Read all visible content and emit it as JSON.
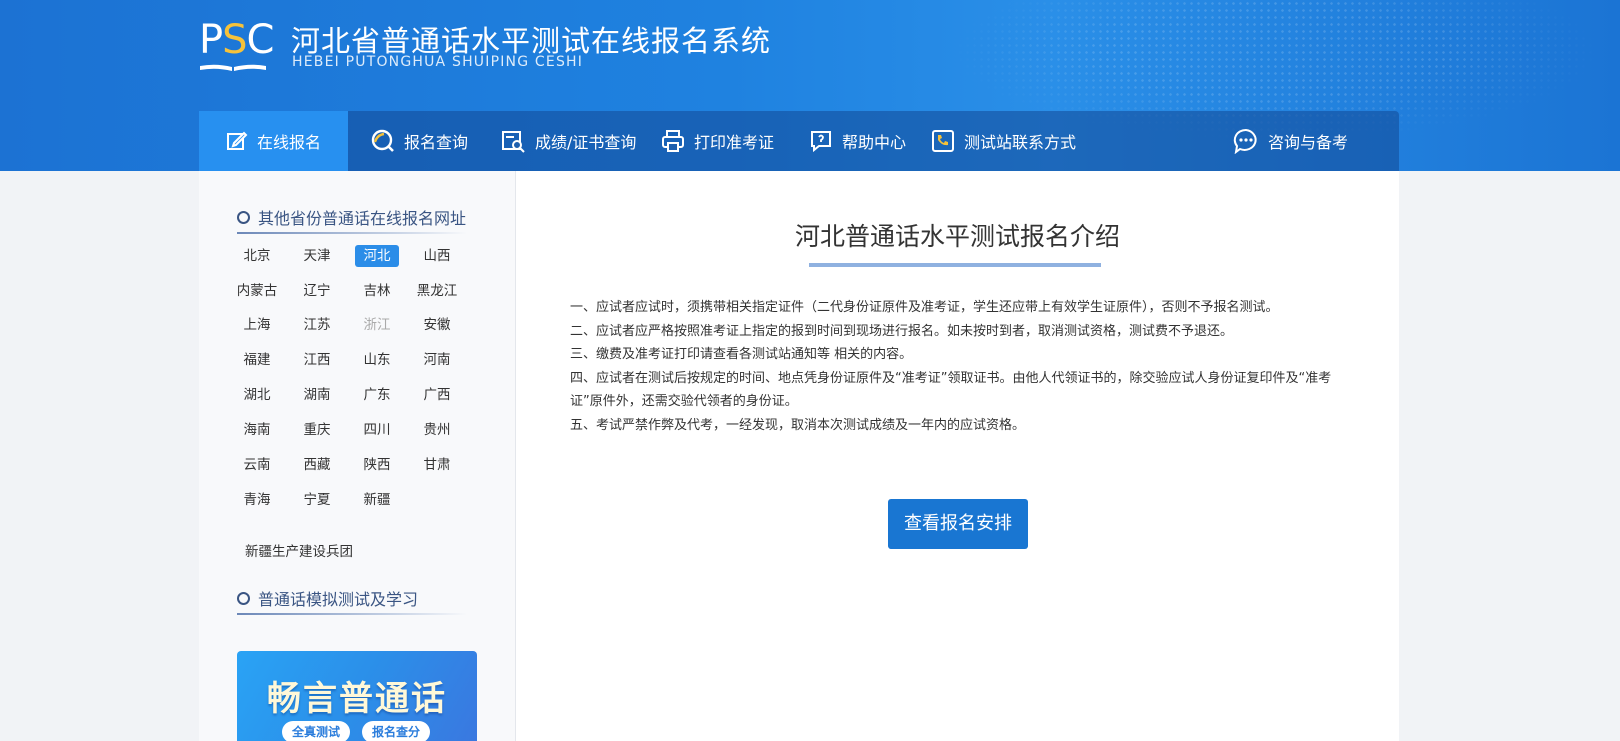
{
  "header": {
    "logo_text_p": "P",
    "logo_text_s": "S",
    "logo_text_c": "C",
    "title": "河北省普通话水平测试在线报名系统",
    "subtitle": "HEBEI PUTONGHUA SHUIPING CESHI"
  },
  "nav": {
    "items": [
      {
        "label": "在线报名",
        "icon": "edit-icon",
        "active": true
      },
      {
        "label": "报名查询",
        "icon": "search-ring-icon"
      },
      {
        "label": "成绩/证书查询",
        "icon": "certificate-search-icon"
      },
      {
        "label": "打印准考证",
        "icon": "printer-icon"
      },
      {
        "label": "帮助中心",
        "icon": "help-icon"
      },
      {
        "label": "测试站联系方式",
        "icon": "phone-icon"
      },
      {
        "label": "咨询与备考",
        "icon": "chat-icon"
      }
    ]
  },
  "sidebar": {
    "provinces_heading": "其他省份普通话在线报名网址",
    "provinces": [
      "北京",
      "天津",
      "河北",
      "山西",
      "内蒙古",
      "辽宁",
      "吉林",
      "黑龙江",
      "上海",
      "江苏",
      "浙江",
      "安徽",
      "福建",
      "江西",
      "山东",
      "河南",
      "湖北",
      "湖南",
      "广东",
      "广西",
      "海南",
      "重庆",
      "四川",
      "贵州",
      "云南",
      "西藏",
      "陕西",
      "甘肃",
      "青海",
      "宁夏",
      "新疆"
    ],
    "active_province": "河北",
    "muted_province": "浙江",
    "extra_link": "新疆生产建设兵团",
    "study_heading": "普通话模拟测试及学习",
    "banner": {
      "title": "畅言普通话",
      "pill_left": "全真测试",
      "pill_right": "报名查分"
    }
  },
  "content": {
    "title": "河北普通话水平测试报名介绍",
    "notes": [
      "一、应试者应试时，须携带相关指定证件（二代身份证原件及准考证，学生还应带上有效学生证原件），否则不予报名测试。",
      "二、应试者应严格按照准考证上指定的报到时间到现场进行报名。如未按时到者，取消测试资格，测试费不予退还。",
      "三、缴费及准考证打印请查看各测试站通知等 相关的内容。",
      "四、应试者在测试后按规定的时间、地点凭身份证原件及“准考证”领取证书。由他人代领证书的，除交验应试人身份证复印件及“准考证”原件外，还需交验代领者的身份证。",
      "五、考试严禁作弊及代考，一经发现，取消本次测试成绩及一年内的应试资格。"
    ],
    "button_label": "查看报名安排"
  },
  "colors": {
    "header_blue": "#1f82e0",
    "nav_active": "#2790f0",
    "button_blue": "#1976d2",
    "logo_accent": "#f6c23a"
  }
}
